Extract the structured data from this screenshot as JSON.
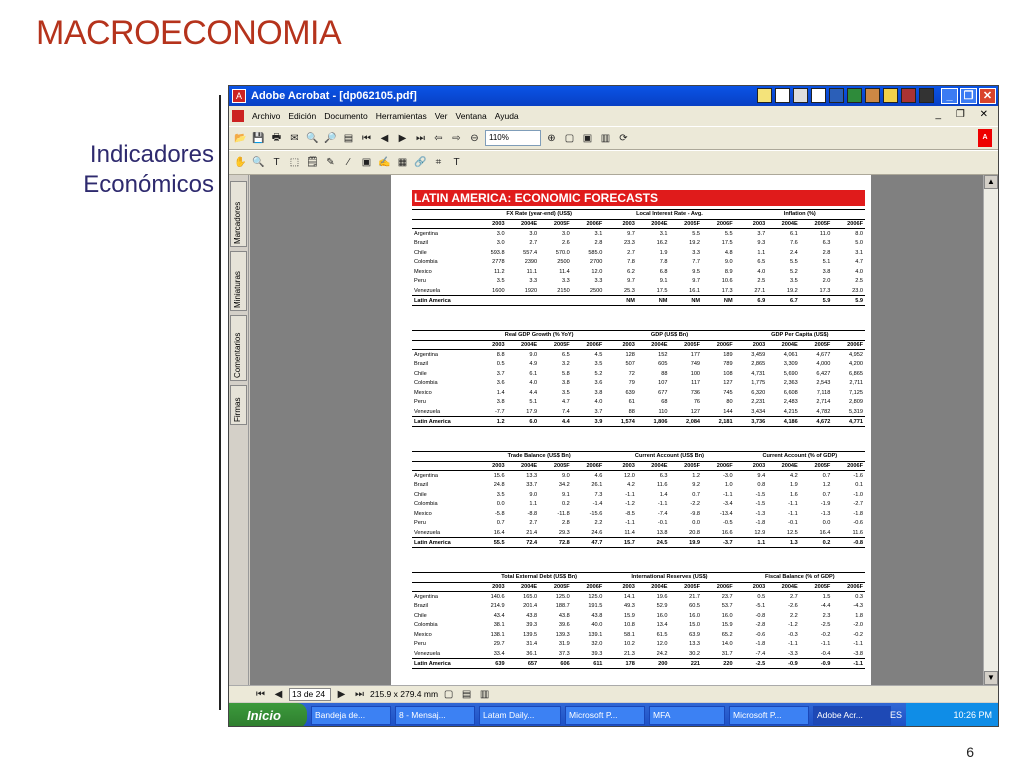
{
  "slide": {
    "title": "MACROECONOMIA",
    "subtitle_line1": "Indicadores",
    "subtitle_line2": "Económicos",
    "page_number": "6"
  },
  "window": {
    "title": "Adobe Acrobat - [dp062105.pdf]",
    "menu": [
      "Archivo",
      "Edición",
      "Documento",
      "Herramientas",
      "Ver",
      "Ventana",
      "Ayuda"
    ],
    "zoom": "110%",
    "page_indicator": "13 de 24",
    "page_size": "215.9 x 279.4 mm",
    "nav_tabs": [
      "Marcadores",
      "Miniaturas",
      "Comentarios",
      "Firmas"
    ]
  },
  "taskbar": {
    "start": "Inicio",
    "tasks": [
      "Bandeja de...",
      "8 - Mensaj...",
      "Latam Daily...",
      "Microsoft P...",
      "MFA",
      "Microsoft P...",
      "Adobe Acr..."
    ],
    "lang": "ES",
    "clock": "10:26 PM"
  },
  "document": {
    "header": "LATIN AMERICA: ECONOMIC FORECASTS",
    "years": [
      "2003",
      "2004E",
      "2005F",
      "2006F"
    ],
    "blocks": [
      {
        "groups": [
          "FX Rate (year-end) (US$)",
          "Local Interest Rate - Avg.",
          "Inflation (%)"
        ],
        "rows": [
          [
            "Argentina",
            "3.0",
            "3.0",
            "3.0",
            "3.1",
            "9.7",
            "3.1",
            "5.5",
            "5.5",
            "3.7",
            "6.1",
            "11.0",
            "8.0"
          ],
          [
            "Brazil",
            "3.0",
            "2.7",
            "2.6",
            "2.8",
            "23.3",
            "16.2",
            "19.2",
            "17.5",
            "9.3",
            "7.6",
            "6.3",
            "5.0"
          ],
          [
            "Chile",
            "593.8",
            "557.4",
            "570.0",
            "585.0",
            "2.7",
            "1.9",
            "3.3",
            "4.8",
            "1.1",
            "2.4",
            "2.8",
            "3.1"
          ],
          [
            "Colombia",
            "2778",
            "2390",
            "2500",
            "2700",
            "7.8",
            "7.8",
            "7.7",
            "9.0",
            "6.5",
            "5.5",
            "5.1",
            "4.7"
          ],
          [
            "Mexico",
            "11.2",
            "11.1",
            "11.4",
            "12.0",
            "6.2",
            "6.8",
            "9.5",
            "8.9",
            "4.0",
            "5.2",
            "3.8",
            "4.0"
          ],
          [
            "Peru",
            "3.5",
            "3.3",
            "3.3",
            "3.3",
            "9.7",
            "9.1",
            "9.7",
            "10.6",
            "2.5",
            "3.5",
            "2.0",
            "2.5"
          ],
          [
            "Venezuela",
            "1600",
            "1920",
            "2150",
            "2500",
            "25.3",
            "17.5",
            "16.1",
            "17.3",
            "27.1",
            "19.2",
            "17.3",
            "23.0"
          ]
        ],
        "total": [
          "Latin America",
          "",
          "",
          "",
          "",
          "NM",
          "NM",
          "NM",
          "NM",
          "6.9",
          "6.7",
          "5.9",
          "5.9"
        ]
      },
      {
        "groups": [
          "Real GDP Growth (% YoY)",
          "GDP (US$ Bn)",
          "GDP Per Capita (US$)"
        ],
        "rows": [
          [
            "Argentina",
            "8.8",
            "9.0",
            "6.5",
            "4.5",
            "128",
            "152",
            "177",
            "189",
            "3,459",
            "4,061",
            "4,677",
            "4,952"
          ],
          [
            "Brazil",
            "0.5",
            "4.9",
            "3.2",
            "3.5",
            "507",
            "605",
            "749",
            "789",
            "2,865",
            "3,309",
            "4,000",
            "4,200"
          ],
          [
            "Chile",
            "3.7",
            "6.1",
            "5.8",
            "5.2",
            "72",
            "88",
            "100",
            "108",
            "4,731",
            "5,690",
            "6,427",
            "6,865"
          ],
          [
            "Colombia",
            "3.6",
            "4.0",
            "3.8",
            "3.6",
            "79",
            "107",
            "117",
            "127",
            "1,775",
            "2,363",
            "2,543",
            "2,711"
          ],
          [
            "Mexico",
            "1.4",
            "4.4",
            "3.5",
            "3.8",
            "639",
            "677",
            "736",
            "745",
            "6,320",
            "6,608",
            "7,118",
            "7,125"
          ],
          [
            "Peru",
            "3.8",
            "5.1",
            "4.7",
            "4.0",
            "61",
            "68",
            "76",
            "80",
            "2,231",
            "2,483",
            "2,714",
            "2,809"
          ],
          [
            "Venezuela",
            "-7.7",
            "17.9",
            "7.4",
            "3.7",
            "88",
            "110",
            "127",
            "144",
            "3,434",
            "4,215",
            "4,782",
            "5,319"
          ]
        ],
        "total": [
          "Latin America",
          "1.2",
          "6.0",
          "4.4",
          "3.9",
          "1,574",
          "1,806",
          "2,084",
          "2,181",
          "3,736",
          "4,186",
          "4,672",
          "4,771"
        ]
      },
      {
        "groups": [
          "Trade Balance (US$ Bn)",
          "Current Account (US$ Bn)",
          "Current Account (% of GDP)"
        ],
        "rows": [
          [
            "Argentina",
            "15.6",
            "13.3",
            "9.0",
            "4.6",
            "12.0",
            "6.3",
            "1.2",
            "-3.0",
            "9.4",
            "4.2",
            "0.7",
            "-1.6"
          ],
          [
            "Brazil",
            "24.8",
            "33.7",
            "34.2",
            "26.1",
            "4.2",
            "11.6",
            "9.2",
            "1.0",
            "0.8",
            "1.9",
            "1.2",
            "0.1"
          ],
          [
            "Chile",
            "3.5",
            "9.0",
            "9.1",
            "7.3",
            "-1.1",
            "1.4",
            "0.7",
            "-1.1",
            "-1.5",
            "1.6",
            "0.7",
            "-1.0"
          ],
          [
            "Colombia",
            "0.0",
            "1.1",
            "0.2",
            "-1.4",
            "-1.2",
            "-1.1",
            "-2.2",
            "-3.4",
            "-1.5",
            "-1.1",
            "-1.9",
            "-2.7"
          ],
          [
            "Mexico",
            "-5.8",
            "-8.8",
            "-11.8",
            "-15.6",
            "-8.5",
            "-7.4",
            "-9.8",
            "-13.4",
            "-1.3",
            "-1.1",
            "-1.3",
            "-1.8"
          ],
          [
            "Peru",
            "0.7",
            "2.7",
            "2.8",
            "2.2",
            "-1.1",
            "-0.1",
            "0.0",
            "-0.5",
            "-1.8",
            "-0.1",
            "0.0",
            "-0.6"
          ],
          [
            "Venezuela",
            "16.4",
            "21.4",
            "29.3",
            "24.6",
            "11.4",
            "13.8",
            "20.8",
            "16.6",
            "12.9",
            "12.5",
            "16.4",
            "11.6"
          ]
        ],
        "total": [
          "Latin America",
          "55.5",
          "72.4",
          "72.8",
          "47.7",
          "15.7",
          "24.5",
          "19.9",
          "-3.7",
          "1.1",
          "1.3",
          "0.2",
          "-0.8"
        ]
      },
      {
        "groups": [
          "Total External Debt (US$ Bn)",
          "International Reserves (US$)",
          "Fiscal Balance (% of GDP)"
        ],
        "rows": [
          [
            "Argentina",
            "140.6",
            "165.0",
            "125.0",
            "125.0",
            "14.1",
            "19.6",
            "21.7",
            "23.7",
            "0.5",
            "2.7",
            "1.5",
            "0.3"
          ],
          [
            "Brazil",
            "214.9",
            "201.4",
            "188.7",
            "191.5",
            "49.3",
            "52.9",
            "60.5",
            "53.7",
            "-5.1",
            "-2.6",
            "-4.4",
            "-4.3"
          ],
          [
            "Chile",
            "43.4",
            "43.8",
            "43.8",
            "43.8",
            "15.9",
            "16.0",
            "16.0",
            "16.0",
            "-0.8",
            "2.2",
            "2.3",
            "1.8"
          ],
          [
            "Colombia",
            "38.1",
            "39.3",
            "39.6",
            "40.0",
            "10.8",
            "13.4",
            "15.0",
            "15.9",
            "-2.8",
            "-1.2",
            "-2.5",
            "-2.0"
          ],
          [
            "Mexico",
            "138.1",
            "139.5",
            "139.3",
            "139.1",
            "58.1",
            "61.5",
            "63.9",
            "65.2",
            "-0.6",
            "-0.3",
            "-0.2",
            "-0.2"
          ],
          [
            "Peru",
            "29.7",
            "31.4",
            "31.9",
            "32.0",
            "10.2",
            "12.0",
            "13.3",
            "14.0",
            "-1.8",
            "-1.1",
            "-1.1",
            "-1.1"
          ],
          [
            "Venezuela",
            "33.4",
            "36.1",
            "37.3",
            "39.3",
            "21.3",
            "24.2",
            "30.2",
            "31.7",
            "-7.4",
            "-3.3",
            "-0.4",
            "-3.8"
          ]
        ],
        "total": [
          "Latin America",
          "639",
          "657",
          "606",
          "611",
          "178",
          "200",
          "221",
          "220",
          "-2.5",
          "-0.9",
          "-0.9",
          "-1.1"
        ]
      }
    ]
  }
}
